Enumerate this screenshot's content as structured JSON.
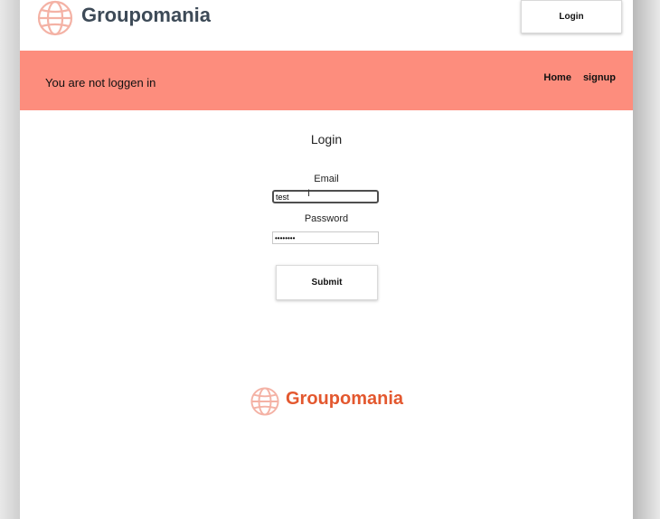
{
  "header": {
    "brand_name": "Groupomania",
    "brand_icon": "globe-icon",
    "login_label": "Login"
  },
  "banner": {
    "status_text": "You are not loggen in",
    "nav": [
      {
        "label": "Home"
      },
      {
        "label": "signup"
      }
    ],
    "color": "#fd8d7d"
  },
  "form": {
    "title": "Login",
    "email_label": "Email",
    "email_value": "test",
    "password_label": "Password",
    "password_value": "••••••••",
    "submit_label": "Submit"
  },
  "footer": {
    "brand_name": "Groupomania",
    "brand_icon": "globe-icon",
    "color": "#e3582f"
  }
}
